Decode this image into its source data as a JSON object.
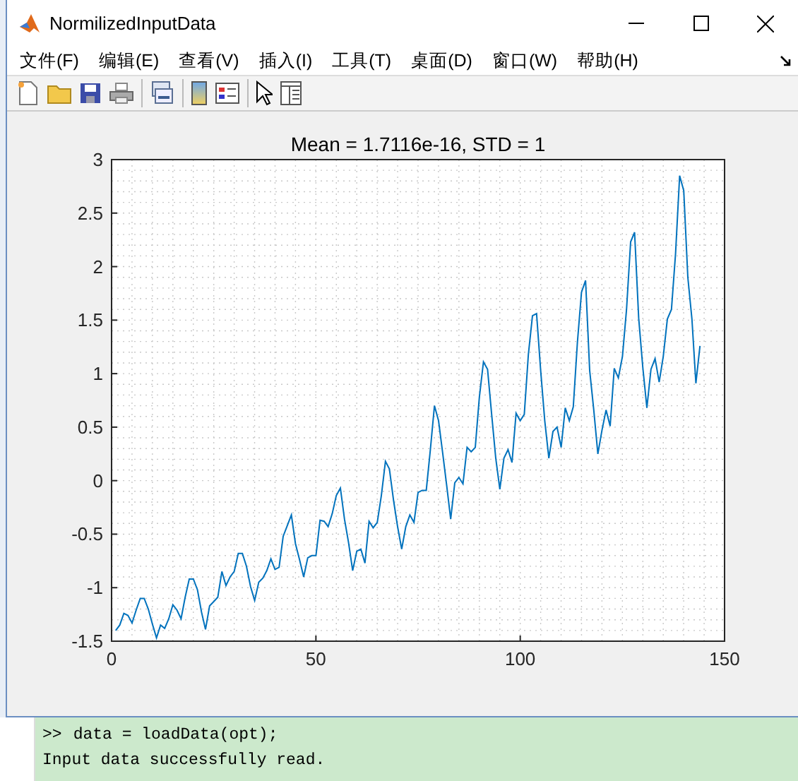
{
  "window": {
    "title": "NormilizedInputData"
  },
  "menu": [
    "文件(F)",
    "编辑(E)",
    "查看(V)",
    "插入(I)",
    "工具(T)",
    "桌面(D)",
    "窗口(W)",
    "帮助(H)"
  ],
  "toolbar_groups": [
    [
      {
        "kind": "new"
      },
      {
        "kind": "open"
      },
      {
        "kind": "save"
      },
      {
        "kind": "print"
      }
    ],
    [
      {
        "kind": "link"
      }
    ],
    [
      {
        "kind": "colorbar"
      },
      {
        "kind": "legend"
      }
    ],
    [
      {
        "kind": "pointer"
      },
      {
        "kind": "panel"
      }
    ]
  ],
  "chart_data": {
    "type": "line",
    "title": "Mean = 1.7116e-16, STD = 1",
    "grid": true,
    "x": [
      1,
      2,
      3,
      4,
      5,
      6,
      7,
      8,
      9,
      10,
      11,
      12,
      13,
      14,
      15,
      16,
      17,
      18,
      19,
      20,
      21,
      22,
      23,
      24,
      25,
      26,
      27,
      28,
      29,
      30,
      31,
      32,
      33,
      34,
      35,
      36,
      37,
      38,
      39,
      40,
      41,
      42,
      43,
      44,
      45,
      46,
      47,
      48,
      49,
      50,
      51,
      52,
      53,
      54,
      55,
      56,
      57,
      58,
      59,
      60,
      61,
      62,
      63,
      64,
      65,
      66,
      67,
      68,
      69,
      70,
      71,
      72,
      73,
      74,
      75,
      76,
      77,
      78,
      79,
      80,
      81,
      82,
      83,
      84,
      85,
      86,
      87,
      88,
      89,
      90,
      91,
      92,
      93,
      94,
      95,
      96,
      97,
      98,
      99,
      100,
      101,
      102,
      103,
      104,
      105,
      106,
      107,
      108,
      109,
      110,
      111,
      112,
      113,
      114,
      115,
      116,
      117,
      118,
      119,
      120,
      121,
      122,
      123,
      124,
      125,
      126,
      127,
      128,
      129,
      130,
      131,
      132,
      133,
      134,
      135,
      136,
      137,
      138,
      139,
      140,
      141,
      142,
      143,
      144
    ],
    "xlim": [
      0,
      150
    ],
    "ylim": [
      -1.5,
      3
    ],
    "xticks": [
      0,
      50,
      100,
      150
    ],
    "yticks": [
      -1.5,
      -1,
      -0.5,
      0,
      0.5,
      1,
      1.5,
      2,
      2.5,
      3
    ],
    "series": [
      {
        "color": "#0072bd",
        "values": [
          -1.4,
          -1.35,
          -1.24,
          -1.26,
          -1.33,
          -1.21,
          -1.1,
          -1.1,
          -1.2,
          -1.34,
          -1.47,
          -1.35,
          -1.38,
          -1.29,
          -1.16,
          -1.21,
          -1.29,
          -1.09,
          -0.92,
          -0.92,
          -1.02,
          -1.23,
          -1.39,
          -1.17,
          -1.13,
          -1.09,
          -0.85,
          -0.98,
          -0.9,
          -0.85,
          -0.68,
          -0.68,
          -0.8,
          -0.99,
          -1.12,
          -0.95,
          -0.91,
          -0.84,
          -0.73,
          -0.83,
          -0.81,
          -0.52,
          -0.42,
          -0.32,
          -0.59,
          -0.74,
          -0.9,
          -0.72,
          -0.7,
          -0.7,
          -0.37,
          -0.38,
          -0.43,
          -0.31,
          -0.14,
          -0.07,
          -0.36,
          -0.58,
          -0.84,
          -0.66,
          -0.64,
          -0.77,
          -0.38,
          -0.44,
          -0.39,
          -0.14,
          0.18,
          0.11,
          -0.18,
          -0.43,
          -0.64,
          -0.43,
          -0.32,
          -0.39,
          -0.11,
          -0.09,
          -0.09,
          0.29,
          0.7,
          0.56,
          0.26,
          -0.05,
          -0.36,
          -0.02,
          0.03,
          -0.03,
          0.31,
          0.27,
          0.31,
          0.78,
          1.11,
          1.04,
          0.62,
          0.21,
          -0.08,
          0.21,
          0.29,
          0.17,
          0.63,
          0.56,
          0.62,
          1.18,
          1.54,
          1.56,
          1.03,
          0.56,
          0.21,
          0.46,
          0.5,
          0.31,
          0.68,
          0.56,
          0.69,
          1.29,
          1.76,
          1.87,
          1.03,
          0.66,
          0.25,
          0.47,
          0.66,
          0.51,
          1.05,
          0.96,
          1.16,
          1.6,
          2.23,
          2.32,
          1.52,
          1.06,
          0.68,
          1.04,
          1.14,
          0.92,
          1.16,
          1.51,
          1.6,
          2.12,
          2.85,
          2.71,
          1.9,
          1.51,
          0.91,
          1.26
        ]
      }
    ]
  },
  "command_window": {
    "lines": [
      {
        "kind": "command",
        "prompt": ">>",
        "text": "data = loadData(opt);"
      },
      {
        "kind": "output",
        "text": "Input data successfully read."
      }
    ]
  }
}
